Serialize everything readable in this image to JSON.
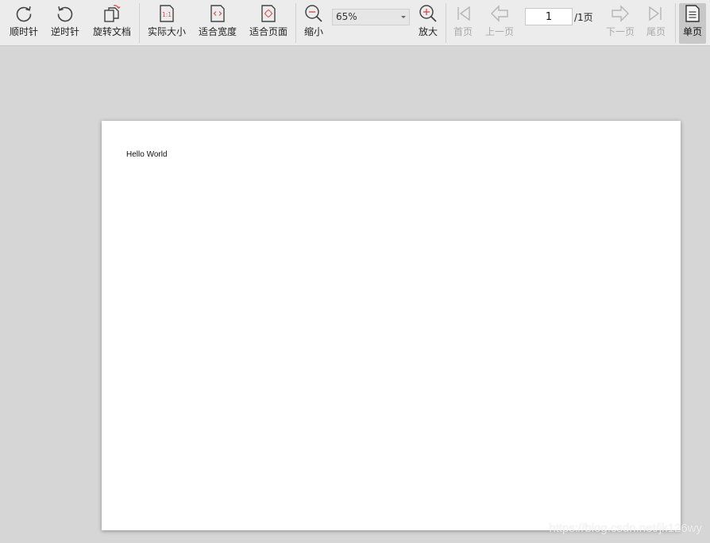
{
  "toolbar": {
    "rotate_cw": "顺时针",
    "rotate_ccw": "逆时针",
    "rotate_doc": "旋转文档",
    "actual_size": "实际大小",
    "fit_width": "适合宽度",
    "fit_page": "适合页面",
    "zoom_out": "缩小",
    "zoom_value": "65%",
    "zoom_in": "放大",
    "first_page": "首页",
    "prev_page": "上一页",
    "current_page": "1",
    "total_pages": "/1页",
    "next_page": "下一页",
    "last_page": "尾页",
    "single_page": "单页",
    "actual_size_glyph": "1:1"
  },
  "document": {
    "text": "Hello World"
  },
  "watermark": "https://blog.csdn.net/jk126wy",
  "colors": {
    "accent": "#d9534f",
    "toolbar_bg": "#ececec",
    "workspace_bg": "#d6d6d6",
    "disabled": "#aaaaaa"
  }
}
